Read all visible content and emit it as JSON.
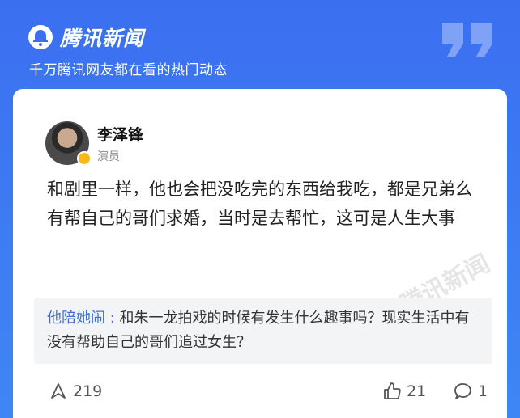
{
  "brand": {
    "name": "腾讯新闻",
    "tagline": "千万腾讯网友都在看的热门动态"
  },
  "author": {
    "name": "李泽锋",
    "role": "演员"
  },
  "answer": {
    "paragraphs": [
      "和剧里一样，他也会把没吃完的东西给我吃，都是兄弟么",
      "有帮自己的哥们求婚，当时是去帮忙，这可是人生大事"
    ]
  },
  "question": {
    "label": "他陪她闹 :",
    "text": " 和朱一龙拍戏的时候有发生什么趣事吗？现实生活中有没有帮助自己的哥们追过女生？"
  },
  "watermark": {
    "text": "腾讯新闻"
  },
  "footer": {
    "share_count": "219",
    "like_count": "21",
    "comment_count": "1"
  },
  "colors": {
    "banner": "#3b6ff0",
    "question_label": "#3d6fd6",
    "verified": "#f6b81d"
  }
}
